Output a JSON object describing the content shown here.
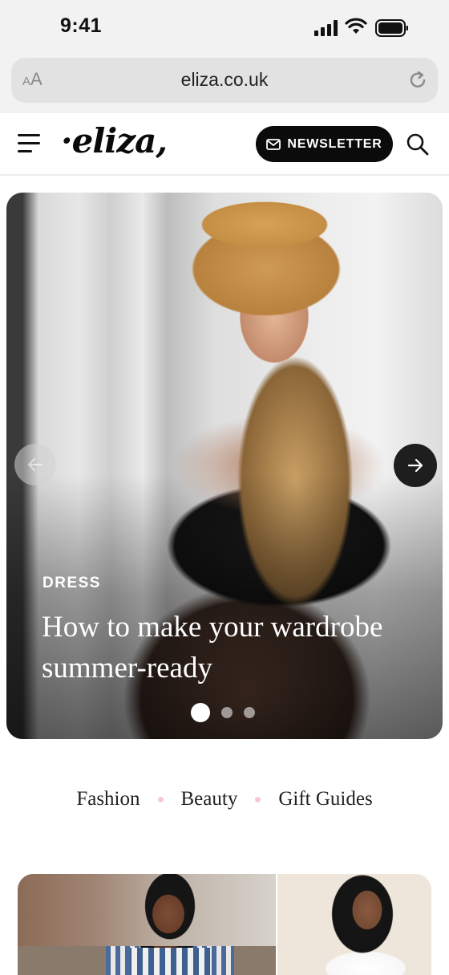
{
  "status_bar": {
    "time": "9:41",
    "icons": [
      "signal-icon",
      "wifi-icon",
      "battery-icon"
    ]
  },
  "browser": {
    "text_size_small": "A",
    "text_size_large": "A",
    "url": "eliza.co.uk",
    "icons": [
      "reload-icon"
    ]
  },
  "header": {
    "logo": "·eliza,",
    "newsletter_label": "NEWSLETTER",
    "icons": [
      "menu-icon",
      "mail-icon",
      "search-icon"
    ]
  },
  "hero": {
    "category": "DRESS",
    "title": "How to make your wardrobe summer-ready",
    "slide_count": 3,
    "active_slide": 1,
    "icons": [
      "arrow-left-icon",
      "arrow-right-icon"
    ]
  },
  "categories": [
    {
      "label": "Fashion"
    },
    {
      "label": "Beauty"
    },
    {
      "label": "Gift Guides"
    }
  ],
  "colors": {
    "accent_dot": "#f5c8d4",
    "button": "#0b0b0b",
    "status_bg": "#f2f2f2"
  }
}
